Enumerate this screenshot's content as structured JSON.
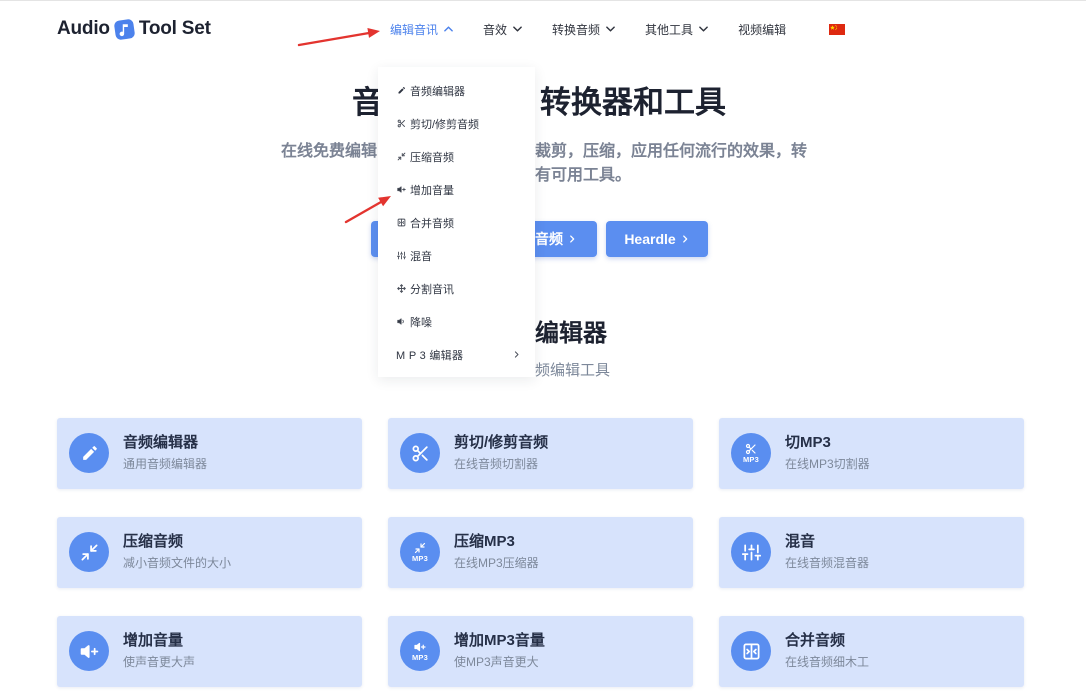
{
  "colors": {
    "accent": "#4c82ec",
    "button": "#5b8ef0",
    "card_bg": "#d7e3fc",
    "icon_circle": "#5a8ef0",
    "annotation_red": "#e3342f",
    "flag_red": "#de2910",
    "flag_yellow": "#ffde00",
    "text_dark": "#1d2230",
    "text_gray": "#7b8394",
    "text_light": "#7d889a"
  },
  "logo": {
    "left": "Audio",
    "right": "Tool Set",
    "icon": "music-note-icon"
  },
  "nav": {
    "items": [
      {
        "label": "编辑音讯",
        "active": true,
        "chevron": "chevron-up-icon"
      },
      {
        "label": "音效",
        "active": false,
        "chevron": "chevron-down-icon"
      },
      {
        "label": "转换音频",
        "active": false,
        "chevron": "chevron-down-icon"
      },
      {
        "label": "其他工具",
        "active": false,
        "chevron": "chevron-down-icon"
      },
      {
        "label": "视频编辑",
        "active": false,
        "chevron": null
      }
    ],
    "language_icon": "china-flag-icon"
  },
  "dropdown": {
    "items": [
      {
        "icon": "pencil-icon",
        "label": "音频编辑器"
      },
      {
        "icon": "scissors-icon",
        "label": "剪切/修剪音频"
      },
      {
        "icon": "compress-icon",
        "label": "压缩音频"
      },
      {
        "icon": "volume-plus-icon",
        "label": "增加音量"
      },
      {
        "icon": "merge-icon",
        "label": "合并音频"
      },
      {
        "icon": "mixer-icon",
        "label": "混音"
      },
      {
        "icon": "split-icon",
        "label": "分割音讯"
      },
      {
        "icon": "noise-reduction-icon",
        "label": "降噪"
      },
      {
        "icon": null,
        "label": "M P 3 编辑器",
        "submenu_icon": "chevron-right-icon"
      }
    ]
  },
  "hero": {
    "title_parts": [
      "音",
      "转换器和工具"
    ],
    "subtitle_line1_left": "在线免费编辑",
    "subtitle_line1_right": "裁剪，压缩，应用任何流行的效果，转",
    "subtitle_line2_right": "有可用工具。",
    "buttons": [
      {
        "label": "音频",
        "icon": "chevron-right-icon"
      },
      {
        "label": "Heardle",
        "icon": "chevron-right-icon"
      }
    ]
  },
  "section": {
    "title": "编辑器",
    "subtitle": "频编辑工具"
  },
  "cards": [
    {
      "icon": "pencil-icon",
      "title": "音频编辑器",
      "description": "通用音频编辑器"
    },
    {
      "icon": "scissors-icon",
      "title": "剪切/修剪音频",
      "description": "在线音频切割器"
    },
    {
      "icon": "scissors-mp3-icon",
      "icon_text": "MP3",
      "title": "切MP3",
      "description": "在线MP3切割器"
    },
    {
      "icon": "compress-icon",
      "title": "压缩音频",
      "description": "减小音频文件的大小"
    },
    {
      "icon": "compress-mp3-icon",
      "icon_text": "MP3",
      "title": "压缩MP3",
      "description": "在线MP3压缩器"
    },
    {
      "icon": "mixer-icon",
      "title": "混音",
      "description": "在线音频混音器"
    },
    {
      "icon": "volume-plus-icon",
      "title": "增加音量",
      "description": "使声音更大声"
    },
    {
      "icon": "volume-mp3-icon",
      "icon_text": "MP3",
      "title": "增加MP3音量",
      "description": "使MP3声音更大"
    },
    {
      "icon": "merge-icon",
      "title": "合并音频",
      "description": "在线音频细木工"
    }
  ]
}
